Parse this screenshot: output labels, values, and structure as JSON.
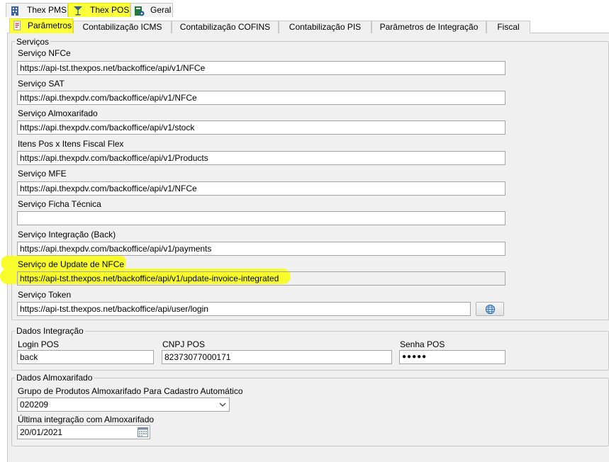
{
  "tabs": [
    {
      "label": "Thex PMS",
      "icon": "building-icon"
    },
    {
      "label": "Thex POS",
      "icon": "cocktail-icon"
    },
    {
      "label": "Geral",
      "icon": "settings-document-icon"
    }
  ],
  "subtabs": [
    {
      "label": "Parâmetros",
      "icon": "parameters-icon"
    },
    {
      "label": "Contabilização ICMS"
    },
    {
      "label": "Contabilização COFINS"
    },
    {
      "label": "Contabilização PIS"
    },
    {
      "label": "Parâmetros de Integração"
    },
    {
      "label": "Fiscal"
    }
  ],
  "servicos": {
    "title": "Serviços",
    "fields": [
      {
        "label": "Serviço NFCe",
        "value": "https://api-tst.thexpos.net/backoffice/api/v1/NFCe"
      },
      {
        "label": "Serviço SAT",
        "value": "https://api.thexpdv.com/backoffice/api/v1/NFCe"
      },
      {
        "label": "Serviço Almoxarifado",
        "value": "https://api.thexpdv.com/backoffice/api/v1/stock"
      },
      {
        "label": "Itens Pos x Itens Fiscal Flex",
        "value": "https://api.thexpdv.com/backoffice/api/v1/Products"
      },
      {
        "label": "Serviço MFE",
        "value": "https://api.thexpdv.com/backoffice/api/v1/NFCe"
      },
      {
        "label": "Serviço Ficha Técnica",
        "value": ""
      },
      {
        "label": "Serviço Integração (Back)",
        "value": "https://api.thexpdv.com/backoffice/api/v1/payments"
      },
      {
        "label": "Serviço de Update de NFCe",
        "value": "https://api-tst.thexpos.net/backoffice/api/v1/update-invoice-integrated"
      },
      {
        "label": "Serviço Token",
        "value": "https://api-tst.thexpos.net/backoffice/api/user/login"
      }
    ]
  },
  "integracao": {
    "title": "Dados Integração",
    "login_label": "Login POS",
    "login_value": "back",
    "cnpj_label": "CNPJ POS",
    "cnpj_value": "82373077000171",
    "senha_label": "Senha POS",
    "senha_value": "●●●●●"
  },
  "almoxarifado": {
    "title": "Dados Almoxarifado",
    "grupo_label": "Grupo de Produtos Almoxarifado Para Cadastro Automático",
    "grupo_value": "020209",
    "ultima_label": "Última integração com Almoxarifado",
    "ultima_value": "20/01/2021"
  },
  "colors": {
    "highlight": "#fbff3a",
    "panel": "#f0f0f0",
    "border": "#c8c8c8"
  }
}
